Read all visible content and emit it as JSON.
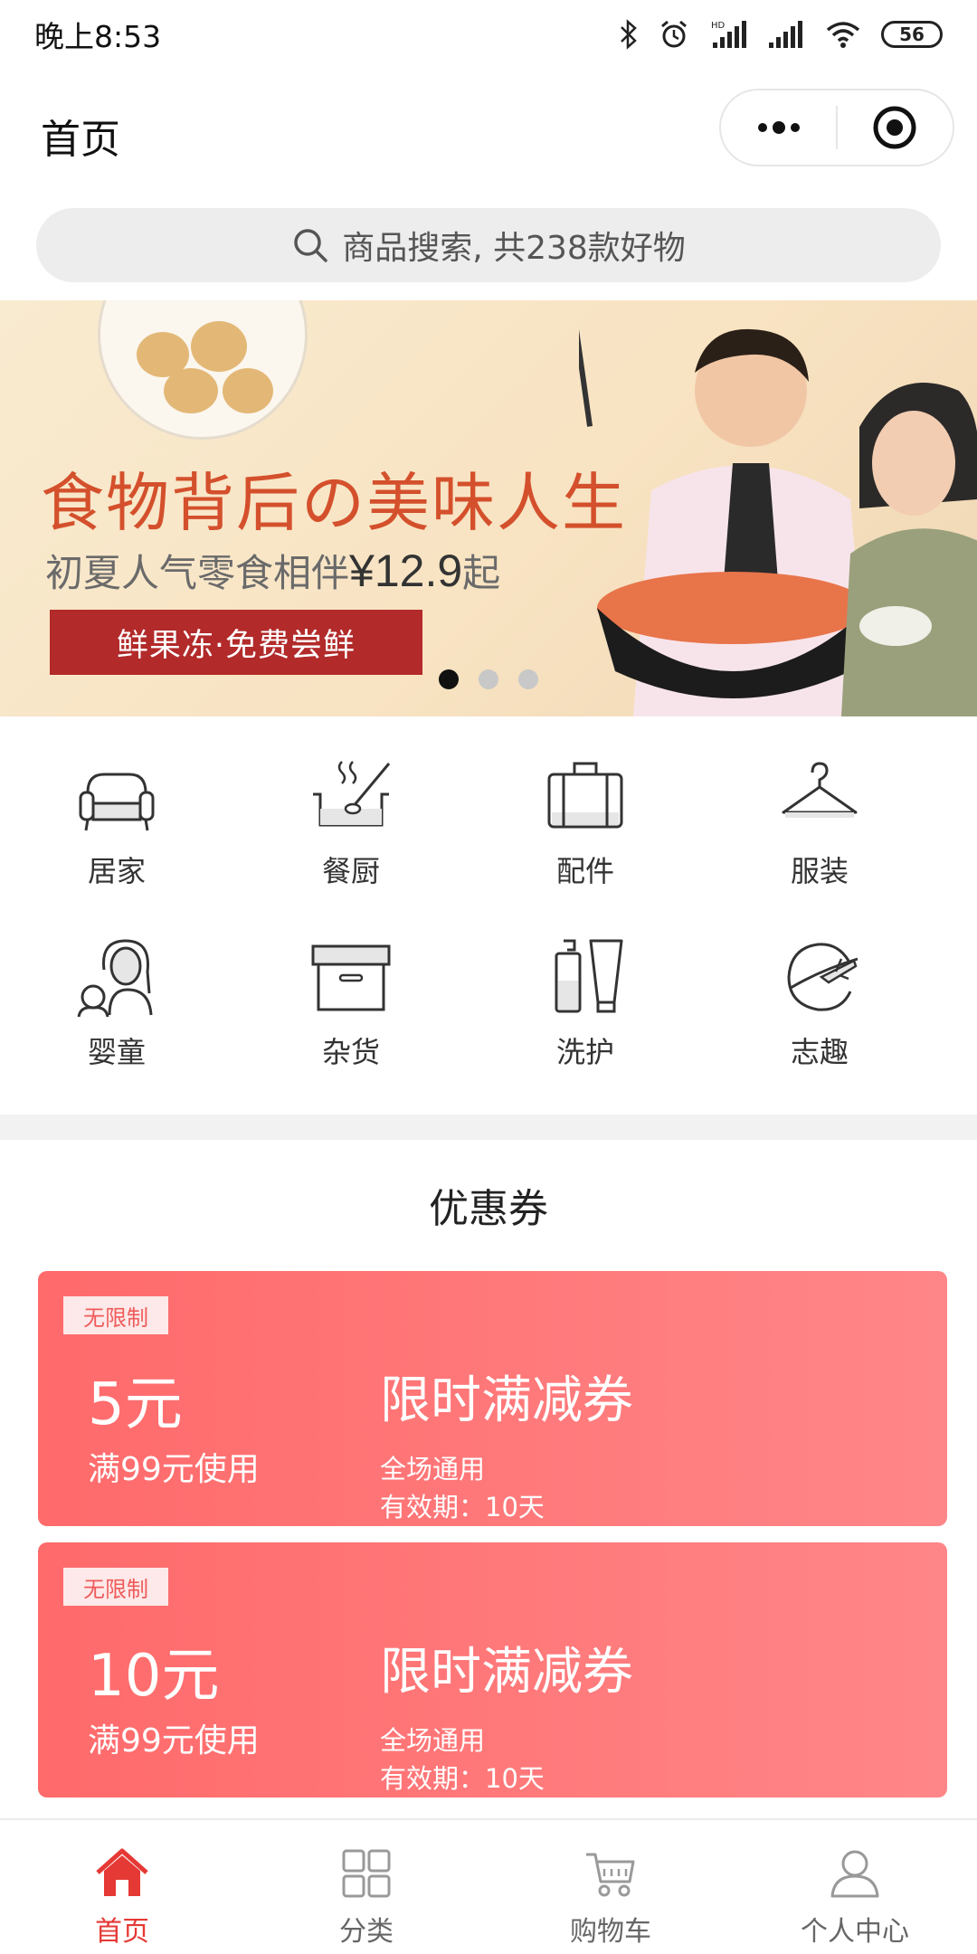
{
  "status_bar": {
    "time": "晚上8:53",
    "battery": "56"
  },
  "header": {
    "title": "首页"
  },
  "search": {
    "placeholder": "商品搜索, 共238款好物"
  },
  "banner": {
    "headline": "食物背后の美味人生",
    "subtitle": "初夏人气零食相伴",
    "price": "¥12.9",
    "price_suffix": "起",
    "cta": "鲜果冻·免费尝鲜",
    "slides": 3,
    "active_slide": 1
  },
  "categories": [
    {
      "label": "居家",
      "icon": "sofa-icon"
    },
    {
      "label": "餐厨",
      "icon": "cooking-pot-icon"
    },
    {
      "label": "配件",
      "icon": "suitcase-icon"
    },
    {
      "label": "服装",
      "icon": "hanger-icon"
    },
    {
      "label": "婴童",
      "icon": "mother-child-icon"
    },
    {
      "label": "杂货",
      "icon": "storage-box-icon"
    },
    {
      "label": "洗护",
      "icon": "toiletries-icon"
    },
    {
      "label": "志趣",
      "icon": "plane-globe-icon"
    }
  ],
  "coupons_section": {
    "title": "优惠券"
  },
  "coupons": [
    {
      "tag": "无限制",
      "amount": "5元",
      "condition": "满99元使用",
      "name": "限时满减券",
      "scope": "全场通用",
      "validity": "有效期：10天"
    },
    {
      "tag": "无限制",
      "amount": "10元",
      "condition": "满99元使用",
      "name": "限时满减券",
      "scope": "全场通用",
      "validity": "有效期：10天"
    }
  ],
  "tabbar": [
    {
      "label": "首页",
      "icon": "home-icon",
      "active": true
    },
    {
      "label": "分类",
      "icon": "grid-icon",
      "active": false
    },
    {
      "label": "购物车",
      "icon": "cart-icon",
      "active": false
    },
    {
      "label": "个人中心",
      "icon": "user-icon",
      "active": false
    }
  ],
  "colors": {
    "accent": "#e53935",
    "coupon": "#ff6a6b",
    "banner_cta": "#b22a2a"
  }
}
